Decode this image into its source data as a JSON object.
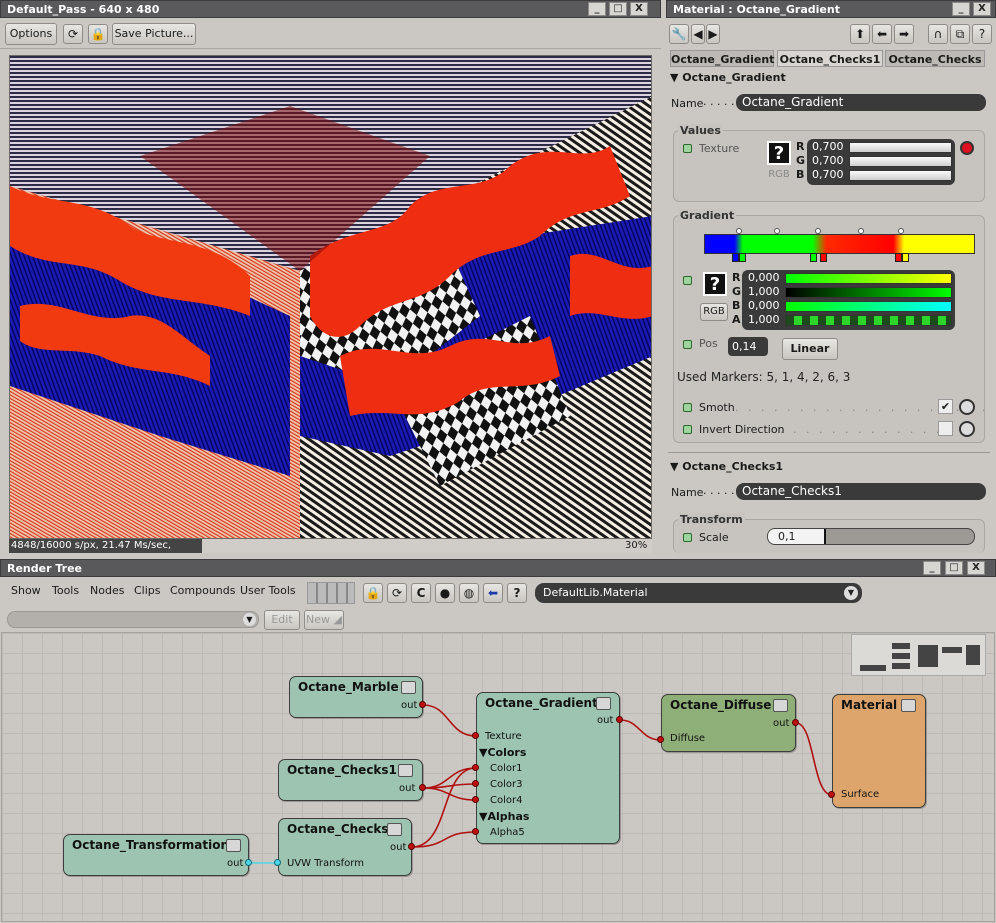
{
  "viewport": {
    "title": "Default_Pass -  640 x 480",
    "options": "Options",
    "save_picture": "Save Picture...",
    "status_left": "4848/16000 s/px, 21.47 Ms/sec,",
    "status_right": "30%",
    "progress": 0.3
  },
  "material": {
    "title": "Material : Octane_Gradient",
    "tabs": [
      "Octane_Gradient",
      "Octane_Checks1",
      "Octane_Checks"
    ],
    "active_tab": 1,
    "gradient_section": "Octane_Gradient",
    "name_label": "Name",
    "name_value": "Octane_Gradient",
    "values_label": "Values",
    "texture_label": "Texture",
    "rgb_button": "RGB",
    "r_label": "R",
    "g_label": "G",
    "b_label": "B",
    "a_label": "A",
    "tex_r": "0,700",
    "tex_g": "0,700",
    "tex_b": "0,700",
    "gradient_label": "Gradient",
    "grad_r": "0,000",
    "grad_g": "1,000",
    "grad_b": "0,000",
    "grad_a": "1,000",
    "pos_label": "Pos",
    "pos_value": "0,14",
    "linear_button": "Linear",
    "used_markers": "Used Markers: 5, 1, 4, 2, 6, 3",
    "smooth_label": "Smoth",
    "smooth_checked": true,
    "invert_label": "Invert Direction",
    "invert_checked": false,
    "checks_section": "Octane_Checks1",
    "checks_name_label": "Name",
    "checks_name_value": "Octane_Checks1",
    "transform_label": "Transform",
    "scale_label": "Scale",
    "scale_value": "0,1"
  },
  "render_tree": {
    "title": "Render Tree",
    "menus": [
      "Show",
      "Tools",
      "Nodes",
      "Clips",
      "Compounds",
      "User Tools"
    ],
    "library": "DefaultLib.Material",
    "edit": "Edit",
    "new": "New",
    "nodes": {
      "marble": {
        "title": "Octane_Marble",
        "out": "out"
      },
      "checks1": {
        "title": "Octane_Checks1",
        "out": "out"
      },
      "transformation": {
        "title": "Octane_Transformation",
        "out": "out"
      },
      "checks": {
        "title": "Octane_Checks",
        "out": "out",
        "in": "UVW Transform"
      },
      "gradient": {
        "title": "Octane_Gradient",
        "out": "out",
        "texture": "Texture",
        "colors": "Colors",
        "color1": "Color1",
        "color3": "Color3",
        "color4": "Color4",
        "alphas": "Alphas",
        "alpha5": "Alpha5"
      },
      "diffuse": {
        "title": "Octane_Diffuse",
        "out": "out",
        "in": "Diffuse"
      },
      "material": {
        "title": "Material",
        "in": "Surface"
      }
    }
  },
  "colors": {
    "node_texture": "#9dc4b1",
    "node_diffuse": "#8faf78",
    "node_material": "#dda56c",
    "wire": "#b01010"
  }
}
